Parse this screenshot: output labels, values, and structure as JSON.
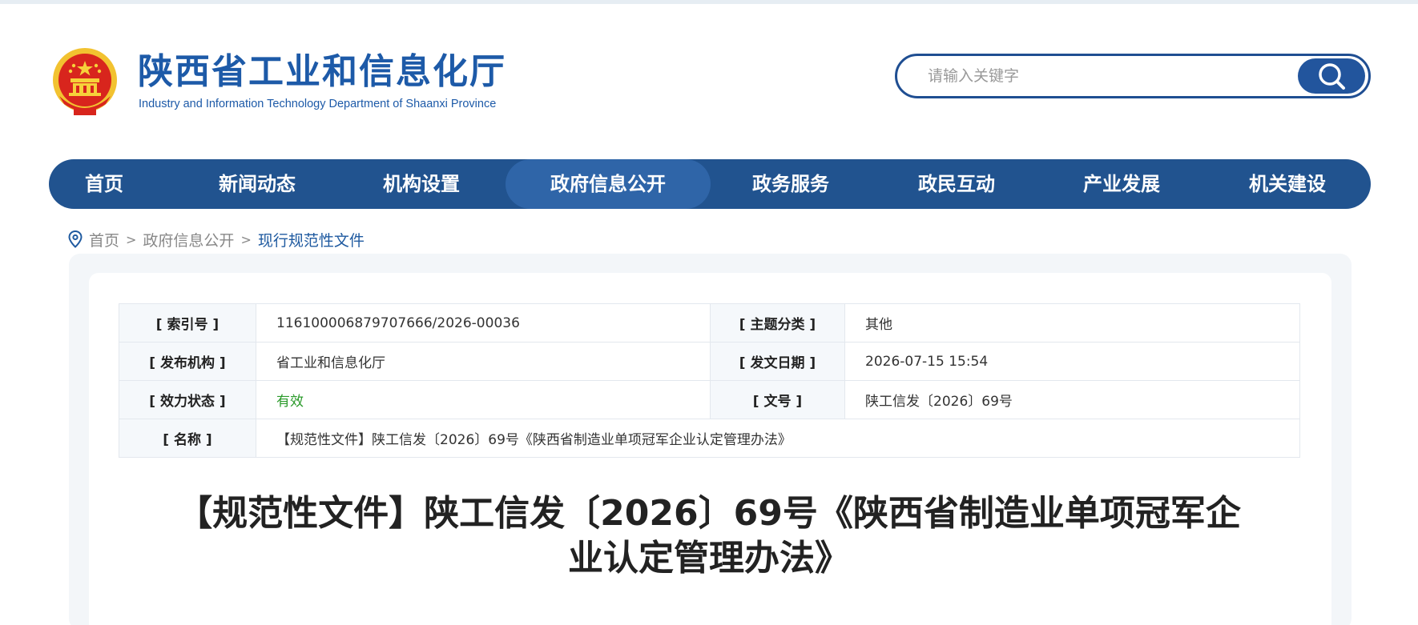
{
  "header": {
    "title": "陕西省工业和信息化厅",
    "subtitle": "Industry and Information Technology Department of Shaanxi Province",
    "emblem_icon": "national-emblem-icon"
  },
  "search": {
    "placeholder": "请输入关键字",
    "button_icon": "search-icon"
  },
  "nav": {
    "items": [
      {
        "label": "首页"
      },
      {
        "label": "新闻动态"
      },
      {
        "label": "机构设置"
      },
      {
        "label": "政府信息公开",
        "active": true
      },
      {
        "label": "政务服务"
      },
      {
        "label": "政民互动"
      },
      {
        "label": "产业发展"
      },
      {
        "label": "机关建设"
      }
    ]
  },
  "breadcrumb": {
    "icon": "location-pin-icon",
    "items": [
      "首页",
      "政府信息公开",
      "现行规范性文件"
    ],
    "separator": ">"
  },
  "meta": {
    "index_label": "[ 索引号 ]",
    "index_value": "116100006879707666/2026-00036",
    "topic_label": "[ 主题分类 ]",
    "topic_value": "其他",
    "publisher_label": "[ 发布机构 ]",
    "publisher_value": "省工业和信息化厅",
    "date_label": "[ 发文日期 ]",
    "date_value": "2026-07-15 15:54",
    "status_label": "[ 效力状态 ]",
    "status_value": "有效",
    "docno_label": "[ 文号 ]",
    "docno_value": "陕工信发〔2026〕69号",
    "name_label": "[ 名称 ]",
    "name_value": "【规范性文件】陕工信发〔2026〕69号《陕西省制造业单项冠军企业认定管理办法》"
  },
  "document": {
    "title": "【规范性文件】陕工信发〔2026〕69号《陕西省制造业单项冠军企业认定管理办法》"
  },
  "colors": {
    "brand_blue": "#1d5aa8",
    "nav_bg": "#21538f",
    "nav_active": "#2f65a8",
    "valid_green": "#2a9a2a"
  }
}
